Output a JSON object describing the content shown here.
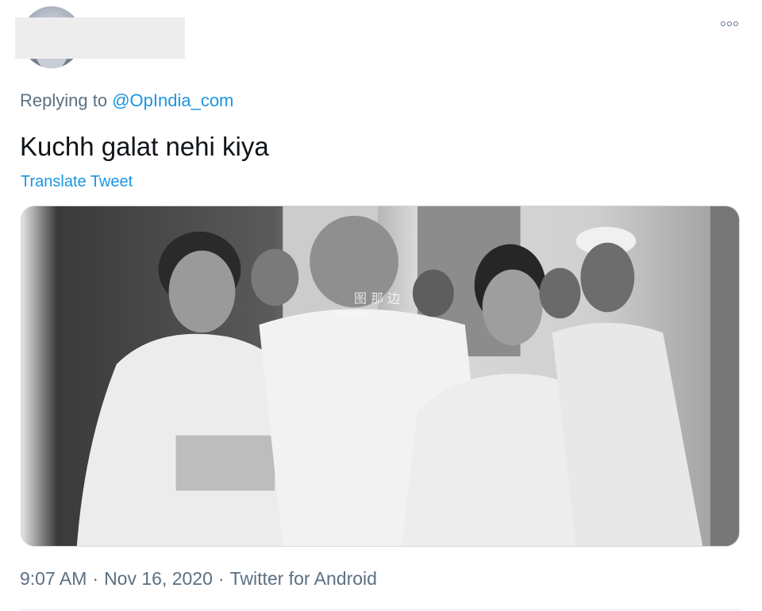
{
  "tweet": {
    "replying_prefix": "Replying to",
    "replying_handle": "@OpIndia_com",
    "text": "Kuchh galat nehi kiya",
    "translate_label": "Translate Tweet",
    "time": "9:07 AM",
    "separator": "·",
    "date": "Nov 16, 2020",
    "source": "Twitter for Android"
  },
  "media": {
    "watermark_line1": "图 那 边",
    "watermark_line2": "Hinablan"
  },
  "icons": {
    "more": "more-horizontal-icon"
  },
  "colors": {
    "link": "#1b95e0",
    "secondary_text": "#5b7083",
    "primary_text": "#0f1419",
    "border": "#cfd9de"
  }
}
